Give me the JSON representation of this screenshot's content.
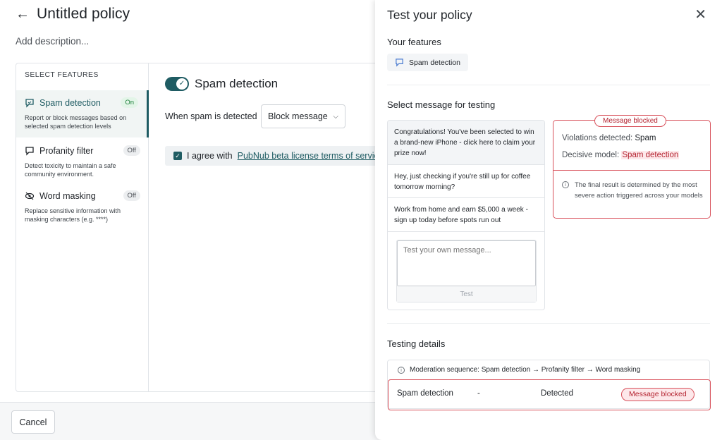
{
  "page": {
    "title": "Untitled policy",
    "description_placeholder": "Add description...",
    "features_heading": "SELECT FEATURES",
    "features": [
      {
        "name": "Spam detection",
        "status": "On",
        "description": "Report or block messages based on selected spam detection levels",
        "icon": "chat-bubble-icon"
      },
      {
        "name": "Profanity filter",
        "status": "Off",
        "description": "Detect toxicity to maintain a safe community environment.",
        "icon": "chat-bubble-icon"
      },
      {
        "name": "Word masking",
        "status": "Off",
        "description": "Replace sensitive information with masking characters (e.g. ****)",
        "icon": "eye-off-icon"
      }
    ],
    "content": {
      "feature_title": "Spam detection",
      "when_label": "When spam is detected",
      "action_selected": "Block message",
      "agree_prefix": "I agree with",
      "agree_link": "PubNub beta license terms of service"
    },
    "cancel_label": "Cancel"
  },
  "drawer": {
    "title": "Test your policy",
    "your_features_label": "Your features",
    "feature_chip": "Spam detection",
    "select_message_label": "Select message for testing",
    "messages": [
      "Congratulations! You've been selected to win a brand-new iPhone - click here to claim your prize now!",
      "Hey, just checking if you're still up for coffee tomorrow morning?",
      "Work from home and earn $5,000 a week - sign up today before spots run out"
    ],
    "test_placeholder": "Test your own message...",
    "test_button": "Test",
    "result": {
      "status": "Message blocked",
      "violations_label": "Violations detected:",
      "violations_value": "Spam",
      "model_label": "Decisive model:",
      "model_value": "Spam detection",
      "info": "The final result is determined by the most severe action triggered across your models"
    },
    "testing_details_label": "Testing details",
    "sequence": "Moderation sequence: Spam detection → Profanity filter → Word masking",
    "detail_row": {
      "feature": "Spam detection",
      "level": "-",
      "outcome": "Detected",
      "action": "Message blocked"
    }
  },
  "colors": {
    "accent": "#1f5c63",
    "danger": "#d8505a",
    "danger_text": "#b42330",
    "danger_bg": "#fde8ea"
  }
}
